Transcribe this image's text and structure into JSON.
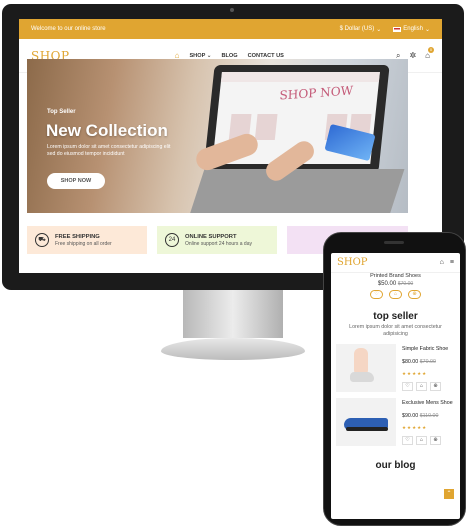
{
  "desktop": {
    "topbar": {
      "welcome": "Welcome to our online store",
      "currency": "$ Dollar (US)",
      "language": "English",
      "chevron": "⌄"
    },
    "nav": {
      "logo": "SHOP",
      "items": [
        "SHOP",
        "BLOG",
        "CONTACT US"
      ],
      "shop_chevron": "⌄",
      "cart_count": "0",
      "icons": {
        "home": "⌂",
        "search": "⌕",
        "settings": "✲",
        "cart": "⌂"
      }
    },
    "hero": {
      "subtitle": "Top Seller",
      "title": "New Collection",
      "description": "Lorem ipsum dolor sit amet consectetur adipiscing elit sed do eiusmod tempor incididunt",
      "button": "SHOP NOW",
      "laptop_text": "SHOP NOW"
    },
    "features": [
      {
        "title": "FREE SHIPPING",
        "desc": "Free shipping on all order",
        "icon": "⛟"
      },
      {
        "title": "ONLINE SUPPORT",
        "desc": "Online support 24 hours a day",
        "icon": "24"
      }
    ]
  },
  "mobile": {
    "logo": "SHOP",
    "icons": {
      "cart": "⌂",
      "menu": "≡"
    },
    "prev_product": {
      "name": "Printed Brand Shoes",
      "price": "$50.00",
      "old_price": "$70.00"
    },
    "top_seller": {
      "title": "top seller",
      "desc": "Lorem ipsum dolor sit amet consectetur adipisicing",
      "products": [
        {
          "name": "Simple Fabric Shoe",
          "price": "$80.00",
          "old_price": "$70.00",
          "stars": "★★★★★"
        },
        {
          "name": "Exclusive Mens Shoe",
          "price": "$90.00",
          "old_price": "$110.00",
          "stars": "★★★★★"
        }
      ]
    },
    "action_icons": {
      "wish": "♡",
      "cart": "⌂",
      "view": "⊕"
    },
    "blog_title": "our blog",
    "scroll_top": "⌃"
  },
  "colors": {
    "accent": "#e0a531"
  }
}
